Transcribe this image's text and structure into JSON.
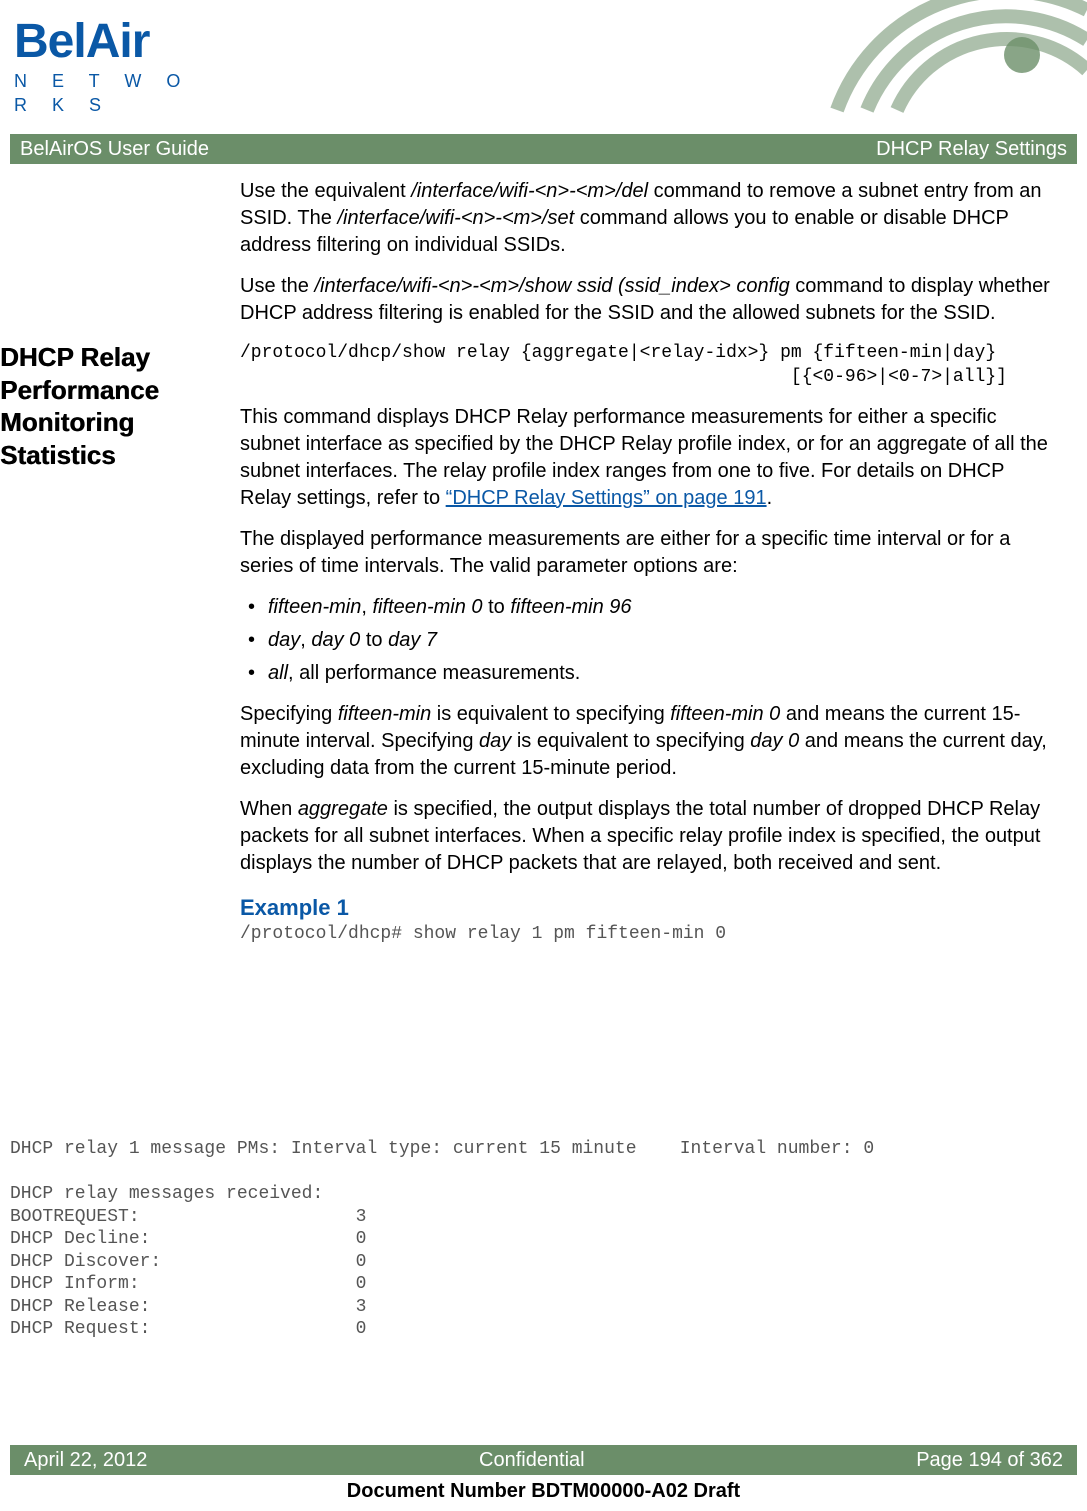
{
  "logo": {
    "brand_top": "BelAir",
    "brand_bottom": "N E T W O R K S"
  },
  "header": {
    "left": "BelAirOS User Guide",
    "right": "DHCP Relay Settings"
  },
  "intro": {
    "p1_a": "Use the equivalent ",
    "p1_cmd1": "/interface/wifi-<n>-<m>/del",
    "p1_b": " command to remove a subnet entry from an SSID. The ",
    "p1_cmd2": "/interface/wifi-<n>-<m>/set",
    "p1_c": " command allows you to enable or disable DHCP address filtering on individual SSIDs.",
    "p2_a": "Use the ",
    "p2_cmd": "/interface/wifi-<n>-<m>/show ssid (ssid_index> config",
    "p2_b": " command to display whether DHCP address filtering is enabled for the SSID and the allowed subnets for the SSID."
  },
  "stats": {
    "heading": "DHCP Relay Performance Monitoring Statistics",
    "syntax_line1": "/protocol/dhcp/show relay {aggregate|<relay-idx>} pm {fifteen-min|day}",
    "syntax_line2": "                                                   [{<0-96>|<0-7>|all}]",
    "p1_a": "This command displays DHCP Relay performance measurements for either a specific subnet interface as specified by the DHCP Relay profile index, or for an aggregate of all the subnet interfaces. The relay profile index ranges from one to five. For details on DHCP Relay settings, refer to ",
    "p1_link": "“DHCP Relay Settings” on page 191",
    "p1_b": ".",
    "p2": "The displayed performance measurements are either for a specific time interval or for a series of time intervals. The valid parameter options are:",
    "opts": {
      "o1_i1": "fifteen-min",
      "o1_t1": ", ",
      "o1_i2": "fifteen-min 0",
      "o1_t2": " to ",
      "o1_i3": "fifteen-min 96",
      "o2_i1": "day",
      "o2_t1": ", ",
      "o2_i2": "day 0 ",
      "o2_t2": "to ",
      "o2_i3": "day 7",
      "o3_i1": "all",
      "o3_t1": ", all performance measurements."
    },
    "p3_a": "Specifying ",
    "p3_i1": "fifteen-min",
    "p3_b": " is equivalent to specifying ",
    "p3_i2": "fifteen-min 0",
    "p3_c": " and means the current 15-minute interval. Specifying ",
    "p3_i3": "day",
    "p3_d": " is equivalent to specifying ",
    "p3_i4": "day 0",
    "p3_e": " and means the current day, excluding data from the current 15-minute period.",
    "p4_a": "When ",
    "p4_i1": "aggregate",
    "p4_b": " is specified, the output displays the total number of dropped DHCP Relay packets for all subnet interfaces. When a specific relay profile index is specified, the output displays the number of DHCP packets that are relayed, both received and sent.",
    "ex_title": "Example 1",
    "ex_cmd": "/protocol/dhcp# show relay 1 pm fifteen-min 0"
  },
  "terminal": "DHCP relay 1 message PMs: Interval type: current 15 minute    Interval number: 0\n\nDHCP relay messages received:\nBOOTREQUEST:                    3\nDHCP Decline:                   0\nDHCP Discover:                  0\nDHCP Inform:                    0\nDHCP Release:                   3\nDHCP Request:                   0",
  "footer": {
    "left": "April 22, 2012",
    "center": "Confidential",
    "right": "Page 194 of 362"
  },
  "docnum": "Document Number BDTM00000-A02 Draft"
}
